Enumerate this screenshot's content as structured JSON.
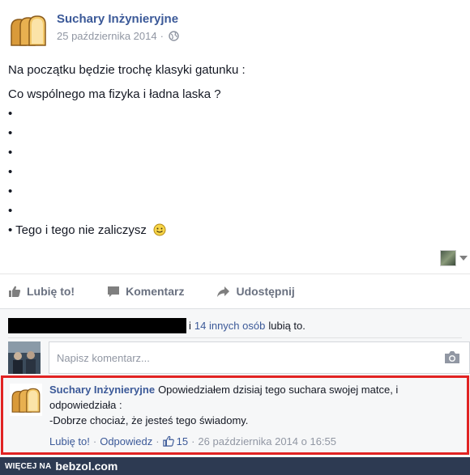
{
  "post": {
    "page_name": "Suchary Inżynieryjne",
    "date": "25 października 2014",
    "meta_separator": "·",
    "lines": {
      "intro": "Na początku będzie trochę klasyki gatunku :",
      "question": "Co wspólnego ma fizyka i ładna laska ?",
      "bullets": [
        "•",
        "•",
        "•",
        "•",
        "•",
        "•"
      ],
      "punchline": "• Tego i tego nie zaliczysz"
    }
  },
  "actions": {
    "like": "Lubię to!",
    "comment": "Komentarz",
    "share": "Udostępnij"
  },
  "likes": {
    "and": "i",
    "others_link": "14 innych osób",
    "suffix": "lubią to."
  },
  "composer": {
    "placeholder": "Napisz komentarz..."
  },
  "comment": {
    "author": "Suchary Inżynieryjne",
    "text_line1": "Opowiedziałem dzisiaj tego suchara swojej matce, i odpowiedziała :",
    "text_line2": "-Dobrze chociaż, że jesteś tego świadomy.",
    "like_link": "Lubię to!",
    "reply_link": "Odpowiedz",
    "sep": "·",
    "like_count": "15",
    "timestamp": "26 października 2014 o 16:55"
  },
  "watermark": {
    "prefix": "WIĘCEJ NA",
    "brand": "bebzol.com"
  },
  "colors": {
    "link_blue": "#3b5998",
    "highlight_red": "#e12323",
    "watermark_bg": "#2d3a52"
  }
}
